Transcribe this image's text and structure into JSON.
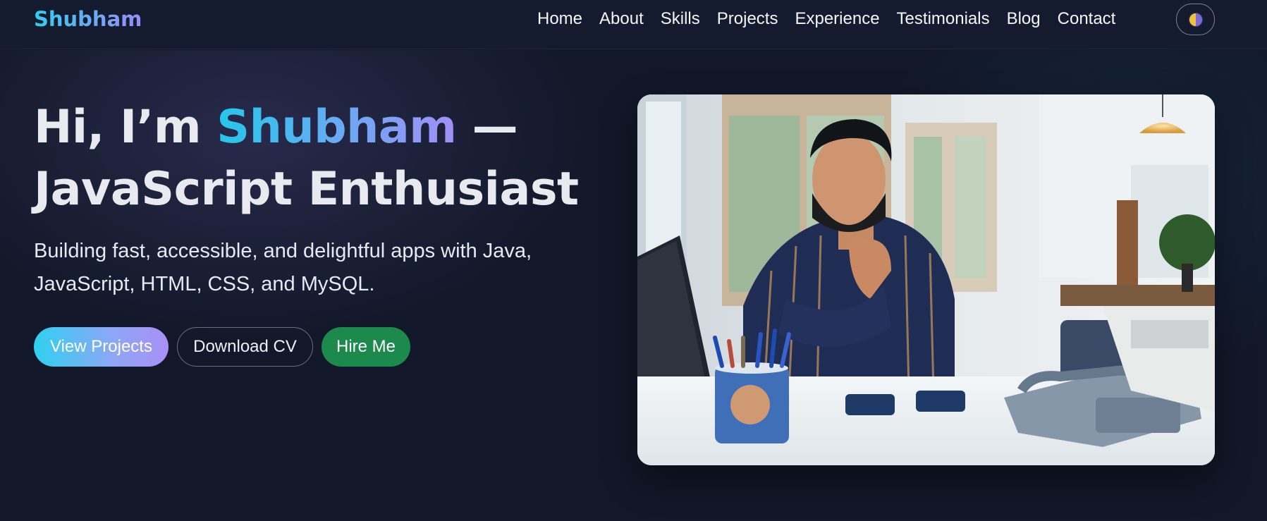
{
  "brand": {
    "name": "Shubham"
  },
  "nav": {
    "items": [
      {
        "label": "Home"
      },
      {
        "label": "About"
      },
      {
        "label": "Skills"
      },
      {
        "label": "Projects"
      },
      {
        "label": "Experience"
      },
      {
        "label": "Testimonials"
      },
      {
        "label": "Blog"
      },
      {
        "label": "Contact"
      }
    ],
    "theme_toggle_icon": "half-moon-theme-icon"
  },
  "hero": {
    "headline_prefix": "Hi, I’m ",
    "headline_name": "Shubham",
    "headline_dash": " —",
    "headline_role": "JavaScript Enthusiast",
    "subtitle": "Building fast, accessible, and delightful apps with Java, JavaScript, HTML, CSS, and MySQL.",
    "buttons": {
      "view_projects": "View Projects",
      "download_cv": "Download CV",
      "hire_me": "Hire Me"
    }
  },
  "colors": {
    "background": "#121829",
    "brand_gradient_start": "#2fd0ee",
    "brand_gradient_end": "#9a8cf7",
    "hire_button": "#1b8a4c"
  }
}
